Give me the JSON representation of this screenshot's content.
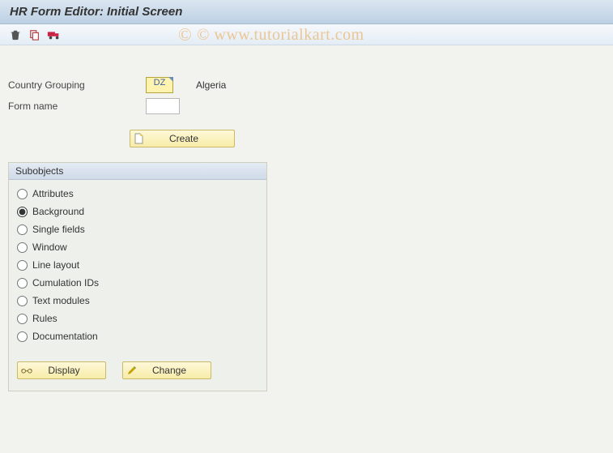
{
  "title": "HR Form Editor: Initial Screen",
  "watermark": "© www.tutorialkart.com",
  "toolbar": {
    "delete_icon": "trash-icon",
    "copy_icon": "copy-icon",
    "transport_icon": "truck-icon"
  },
  "fields": {
    "country_grouping_label": "Country Grouping",
    "country_grouping_value": "DZ",
    "country_grouping_desc": "Algeria",
    "form_name_label": "Form name",
    "form_name_value": ""
  },
  "buttons": {
    "create": "Create",
    "display": "Display",
    "change": "Change"
  },
  "subobjects": {
    "header": "Subobjects",
    "selected": "Background",
    "items": [
      "Attributes",
      "Background",
      "Single fields",
      "Window",
      "Line layout",
      "Cumulation IDs",
      "Text modules",
      "Rules",
      "Documentation"
    ]
  }
}
